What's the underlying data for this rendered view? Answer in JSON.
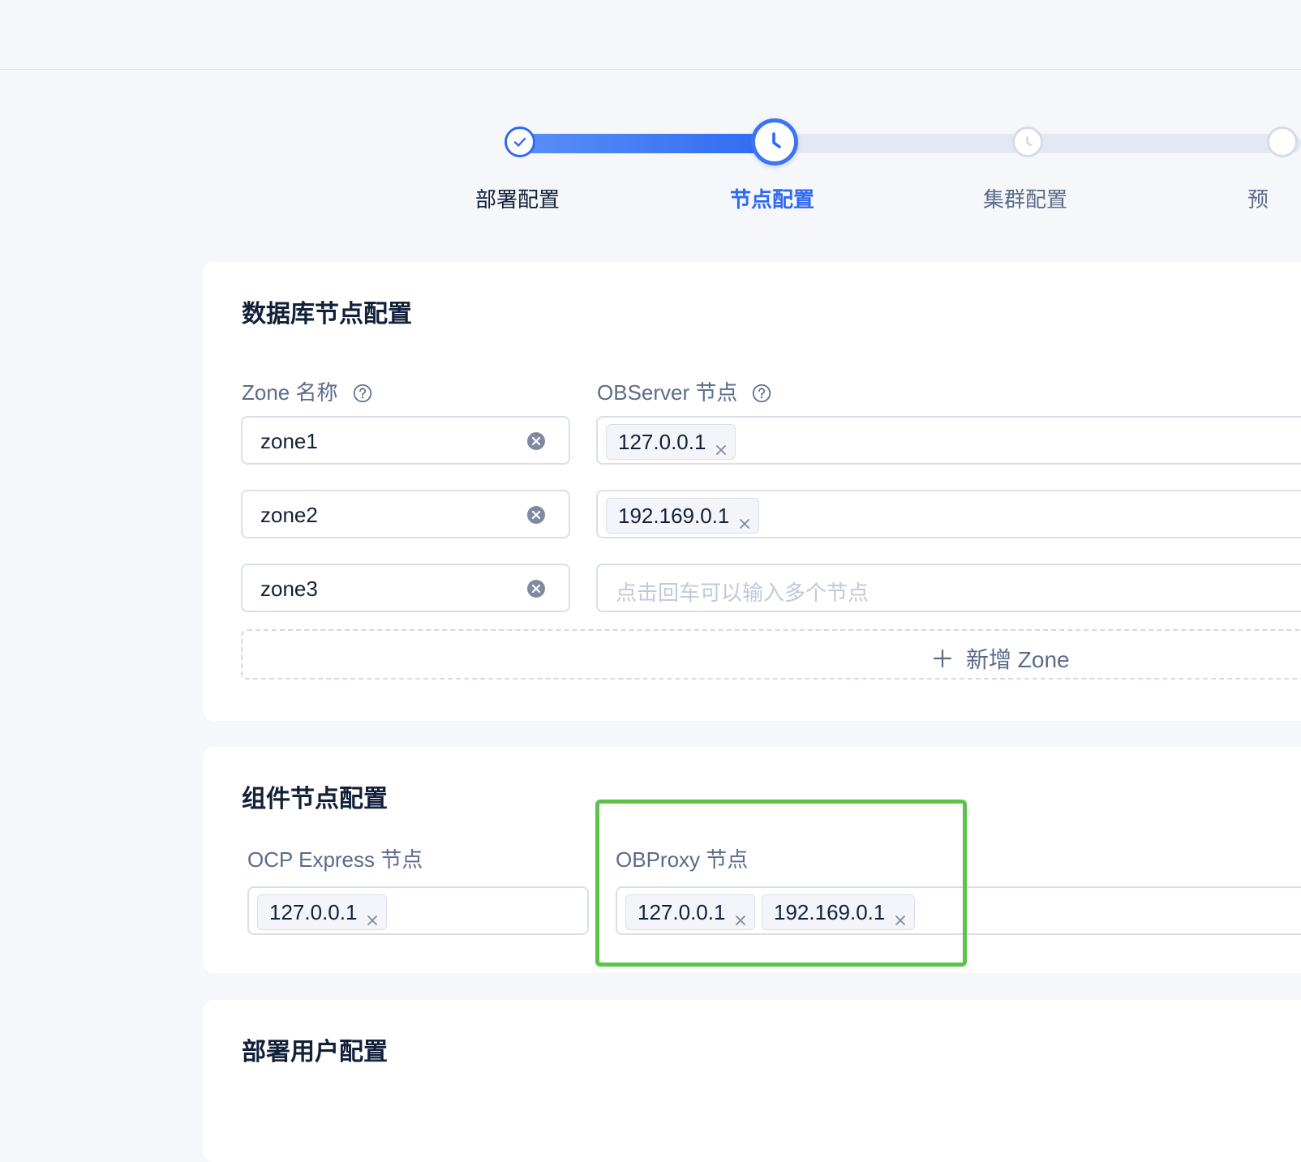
{
  "steps": [
    {
      "label": "部署配置",
      "state": "done"
    },
    {
      "label": "节点配置",
      "state": "current"
    },
    {
      "label": "集群配置",
      "state": "todo"
    },
    {
      "label": "预",
      "state": "todo"
    }
  ],
  "db_card": {
    "title": "数据库节点配置",
    "zone_label": "Zone 名称",
    "observer_label": "OBServer 节点",
    "zones": [
      {
        "name": "zone1",
        "nodes": [
          "127.0.0.1"
        ]
      },
      {
        "name": "zone2",
        "nodes": [
          "192.169.0.1"
        ]
      },
      {
        "name": "zone3",
        "nodes": []
      }
    ],
    "node_placeholder": "点击回车可以输入多个节点",
    "add_zone": "新增 Zone"
  },
  "comp_card": {
    "title": "组件节点配置",
    "ocp_label": "OCP Express 节点",
    "ocp_nodes": [
      "127.0.0.1"
    ],
    "obproxy_label": "OBProxy 节点",
    "obproxy_nodes": [
      "127.0.0.1",
      "192.169.0.1"
    ]
  },
  "user_card": {
    "title": "部署用户配置"
  },
  "colors": {
    "primary": "#2f6af2",
    "highlight": "#5cc24a"
  }
}
